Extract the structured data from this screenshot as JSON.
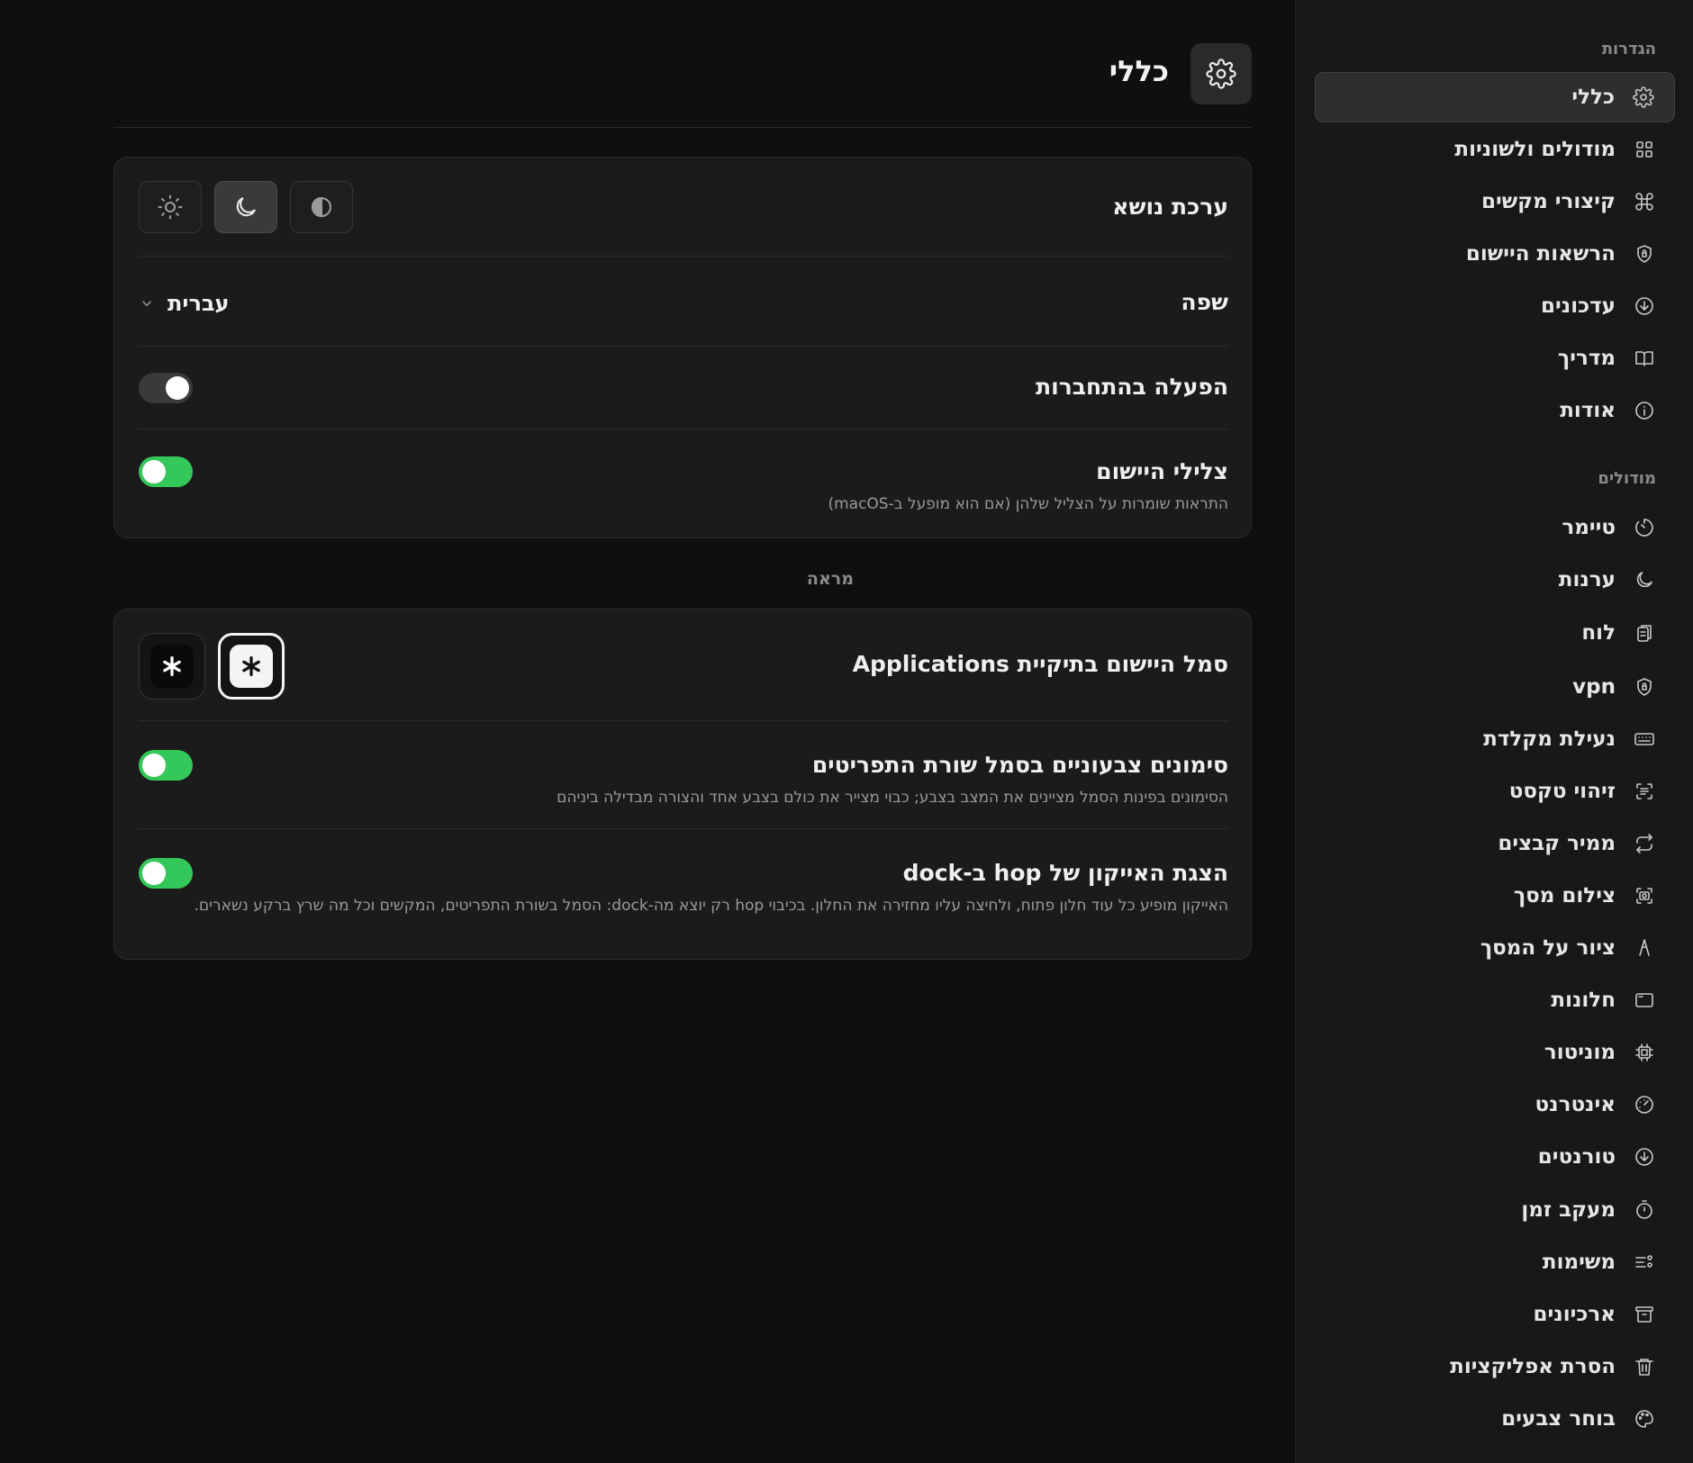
{
  "header": {
    "title": "כללי",
    "icon": "gear-icon"
  },
  "general_card": {
    "theme": {
      "label": "ערכת נושא",
      "options": [
        "light",
        "dark",
        "auto"
      ],
      "selected": "dark"
    },
    "language": {
      "label": "שפה",
      "value": "עברית"
    },
    "launch_at_login": {
      "label": "הפעלה בהתחברות",
      "enabled": false
    },
    "app_sounds": {
      "label": "צלילי היישום",
      "description": "התראות שומרות על הצליל שלהן (אם הוא מופעל ב-macOS)",
      "enabled": true
    }
  },
  "appearance": {
    "section_label": "מראה",
    "app_icon": {
      "label": "סמל היישום בתיקיית Applications",
      "options": [
        "dark",
        "light"
      ],
      "selected": "light"
    },
    "menubar_indicators": {
      "label": "סימונים צבעוניים בסמל שורת התפריטים",
      "description": "הסימונים בפינות הסמל מציינים את המצב בצבע; כבוי מצייר את כולם בצבע אחד והצורה מבדילה ביניהם",
      "enabled": true
    },
    "dock_icon": {
      "label": "הצגת האייקון של hop ב-dock",
      "description": "האייקון מופיע כל עוד חלון פתוח, ולחיצה עליו מחזירה את החלון. בכיבוי hop רק יוצא מה-dock: הסמל בשורת התפריטים, המקשים וכל מה שרץ ברקע נשארים.",
      "enabled": true
    }
  },
  "sidebar": {
    "settings_heading": "הגדרות",
    "settings_items": [
      {
        "label": "כללי",
        "icon": "gear-icon",
        "active": true
      },
      {
        "label": "מודולים ולשוניות",
        "icon": "grid-icon"
      },
      {
        "label": "קיצורי מקשים",
        "icon": "command-icon"
      },
      {
        "label": "הרשאות היישום",
        "icon": "shield-icon"
      },
      {
        "label": "עדכונים",
        "icon": "download-circle-icon"
      },
      {
        "label": "מדריך",
        "icon": "book-icon"
      },
      {
        "label": "אודות",
        "icon": "info-icon"
      }
    ],
    "modules_heading": "מודולים",
    "module_items": [
      {
        "label": "טיימר",
        "icon": "timer-icon"
      },
      {
        "label": "ערנות",
        "icon": "moon-icon"
      },
      {
        "label": "לוח",
        "icon": "clipboard-icon"
      },
      {
        "label": "vpn",
        "icon": "vpn-shield-icon"
      },
      {
        "label": "נעילת מקלדת",
        "icon": "keyboard-icon"
      },
      {
        "label": "זיהוי טקסט",
        "icon": "text-scan-icon"
      },
      {
        "label": "ממיר קבצים",
        "icon": "convert-icon"
      },
      {
        "label": "צילום מסך",
        "icon": "camera-icon"
      },
      {
        "label": "ציור על המסך",
        "icon": "pen-icon"
      },
      {
        "label": "חלונות",
        "icon": "window-icon"
      },
      {
        "label": "מוניטור",
        "icon": "cpu-icon"
      },
      {
        "label": "אינטרנט",
        "icon": "speed-icon"
      },
      {
        "label": "טורנטים",
        "icon": "download-circle-icon"
      },
      {
        "label": "מעקב זמן",
        "icon": "stopwatch-icon"
      },
      {
        "label": "משימות",
        "icon": "tasks-icon"
      },
      {
        "label": "ארכיונים",
        "icon": "archive-icon"
      },
      {
        "label": "הסרת אפליקציות",
        "icon": "trash-icon"
      },
      {
        "label": "בוחר צבעים",
        "icon": "palette-icon"
      }
    ]
  },
  "colors": {
    "toggle_on": "#34c759",
    "background": "#0f0f0f",
    "sidebar": "#181818",
    "card": "#1b1b1b"
  }
}
